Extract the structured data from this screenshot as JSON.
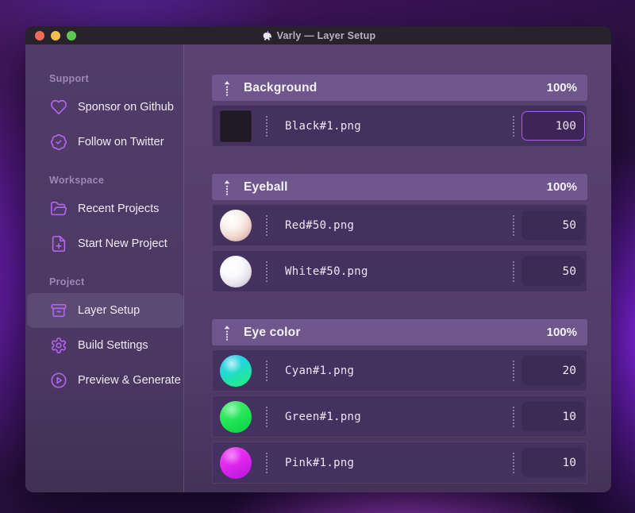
{
  "window": {
    "title": "Varly — Layer Setup"
  },
  "titlebar_buttons": {
    "close": "close",
    "minimize": "minimize",
    "zoom": "zoom"
  },
  "sidebar": {
    "sections": [
      {
        "label": "Support",
        "items": [
          {
            "label": "Sponsor on Github",
            "icon": "heart-icon"
          },
          {
            "label": "Follow on Twitter",
            "icon": "badge-check-icon"
          }
        ]
      },
      {
        "label": "Workspace",
        "items": [
          {
            "label": "Recent Projects",
            "icon": "folder-open-icon"
          },
          {
            "label": "Start New Project",
            "icon": "file-plus-icon"
          }
        ]
      },
      {
        "label": "Project",
        "items": [
          {
            "label": "Layer Setup",
            "icon": "archive-icon",
            "active": true
          },
          {
            "label": "Build Settings",
            "icon": "gear-icon"
          },
          {
            "label": "Preview & Generate",
            "icon": "play-circle-icon"
          }
        ]
      }
    ]
  },
  "layers": [
    {
      "name": "Background",
      "weight": "100%",
      "rows": [
        {
          "file": "Black#1.png",
          "value": "100",
          "thumb": "black-square",
          "focused": true
        }
      ]
    },
    {
      "name": "Eyeball",
      "weight": "100%",
      "rows": [
        {
          "file": "Red#50.png",
          "value": "50",
          "thumb": "red-sphere"
        },
        {
          "file": "White#50.png",
          "value": "50",
          "thumb": "white-sphere"
        }
      ]
    },
    {
      "name": "Eye color",
      "weight": "100%",
      "rows": [
        {
          "file": "Cyan#1.png",
          "value": "20",
          "thumb": "cyan-sphere"
        },
        {
          "file": "Green#1.png",
          "value": "10",
          "thumb": "green-sphere"
        },
        {
          "file": "Pink#1.png",
          "value": "10",
          "thumb": "pink-sphere"
        }
      ]
    }
  ],
  "colors": {
    "accent": "#b264ec",
    "focus_border": "#a95fe8",
    "traffic_red": "#ec6a5e",
    "traffic_yellow": "#f4bf4f",
    "traffic_green": "#61c554"
  }
}
